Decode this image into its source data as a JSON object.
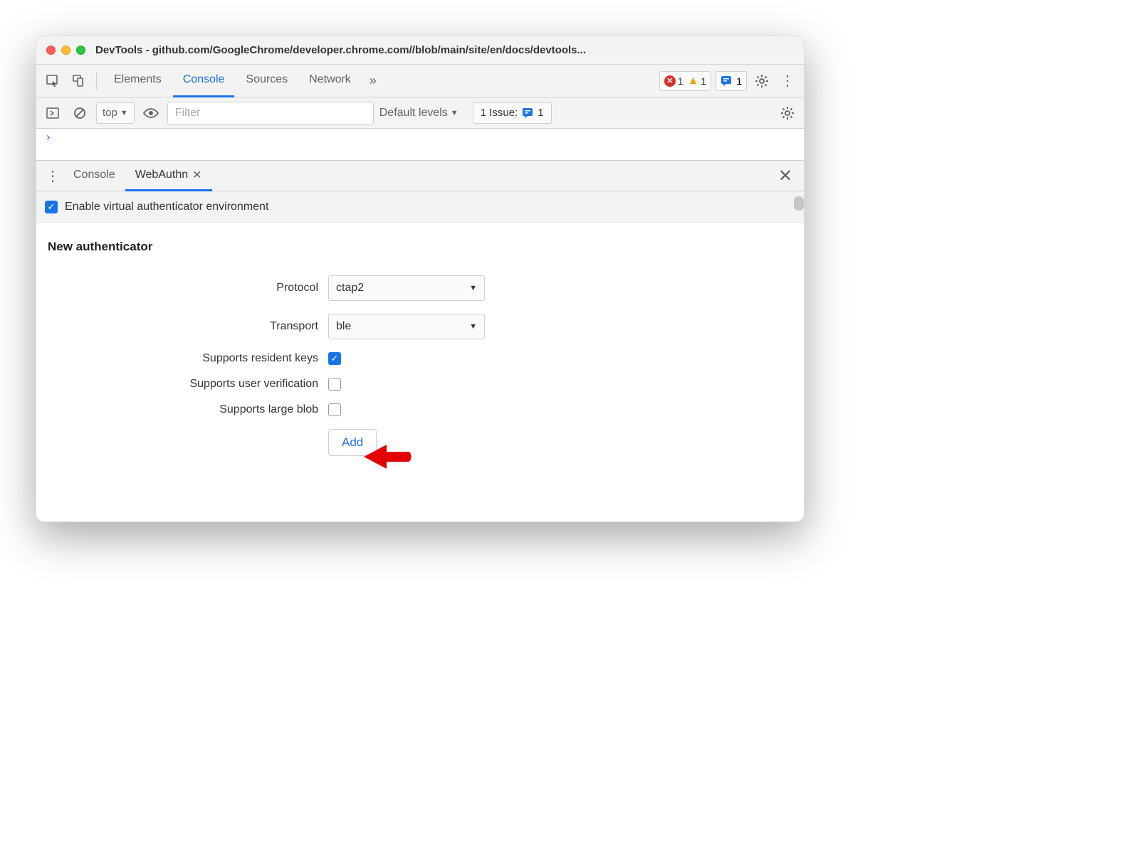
{
  "window": {
    "title": "DevTools - github.com/GoogleChrome/developer.chrome.com//blob/main/site/en/docs/devtools..."
  },
  "toolbar": {
    "tabs": [
      "Elements",
      "Console",
      "Sources",
      "Network"
    ],
    "active_tab": "Console",
    "errors": "1",
    "warnings": "1",
    "issues": "1"
  },
  "console_bar": {
    "context": "top",
    "filter_placeholder": "Filter",
    "levels": "Default levels",
    "issues_label": "1 Issue:",
    "issues_count": "1"
  },
  "drawer": {
    "tabs": [
      "Console",
      "WebAuthn"
    ],
    "active_tab": "WebAuthn",
    "enable_label": "Enable virtual authenticator environment",
    "enable_checked": true
  },
  "webauthn": {
    "heading": "New authenticator",
    "protocol_label": "Protocol",
    "protocol_value": "ctap2",
    "transport_label": "Transport",
    "transport_value": "ble",
    "resident_keys_label": "Supports resident keys",
    "resident_keys_checked": true,
    "user_verification_label": "Supports user verification",
    "user_verification_checked": false,
    "large_blob_label": "Supports large blob",
    "large_blob_checked": false,
    "add_button": "Add"
  }
}
